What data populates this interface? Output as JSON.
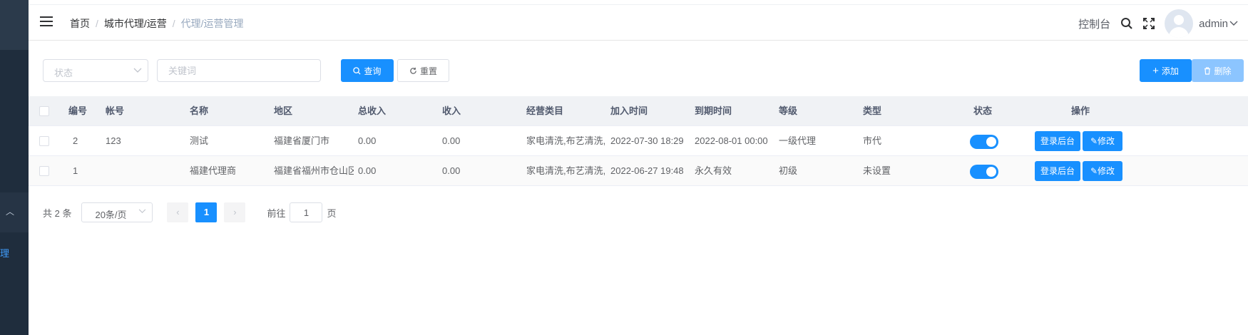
{
  "sidebar": {
    "collapse_icon": "chevron-up-icon",
    "menu_fragment": "理"
  },
  "navbar": {
    "breadcrumb": [
      "首页",
      "城市代理/运营",
      "代理/运营管理"
    ],
    "console_label": "控制台",
    "username": "admin"
  },
  "filters": {
    "status_placeholder": "状态",
    "keyword_placeholder": "关键词",
    "search_label": "查询",
    "reset_label": "重置",
    "add_label": "添加",
    "delete_label": "删除"
  },
  "table": {
    "headers": [
      "编号",
      "帐号",
      "名称",
      "地区",
      "总收入",
      "收入",
      "经营类目",
      "加入时间",
      "到期时间",
      "等级",
      "类型",
      "状态",
      "操作"
    ],
    "rows": [
      {
        "id": "2",
        "account": "123",
        "name": "测试",
        "region": "福建省厦门市",
        "total_income": "0.00",
        "income": "0.00",
        "category": "家电清洗,布艺清洗,消",
        "join_time": "2022-07-30 18:29",
        "expire_time": "2022-08-01 00:00",
        "level": "一级代理",
        "type": "市代",
        "enabled": true
      },
      {
        "id": "1",
        "account": "",
        "name": "福建代理商",
        "region": "福建省福州市仓山区",
        "total_income": "0.00",
        "income": "0.00",
        "category": "家电清洗,布艺清洗,消",
        "join_time": "2022-06-27 19:48",
        "expire_time": "永久有效",
        "level": "初级",
        "type": "未设置",
        "enabled": true
      }
    ],
    "login_label": "登录后台",
    "edit_label": "修改"
  },
  "pagination": {
    "total_text": "共 2 条",
    "page_size": "20条/页",
    "current_page": "1",
    "goto_prefix": "前往",
    "goto_value": "1",
    "goto_suffix": "页"
  },
  "colors": {
    "primary": "#1890ff",
    "sidebar": "#1f2d3d"
  }
}
